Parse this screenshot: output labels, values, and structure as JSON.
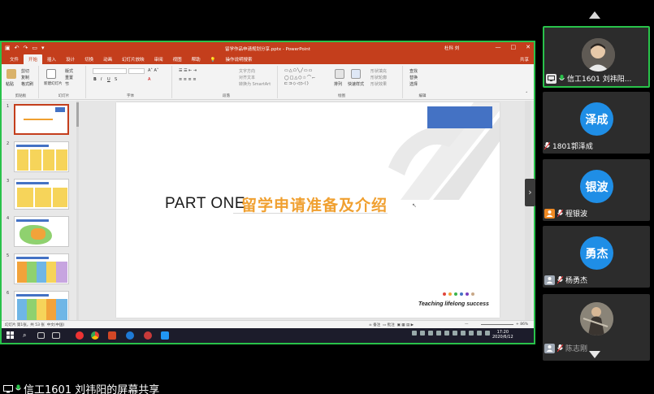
{
  "app": {
    "document_title": "留学作品申请规划分享.pptx - PowerPoint",
    "user": "杜科 刘",
    "tabs": [
      "文件",
      "开始",
      "插入",
      "设计",
      "切换",
      "动画",
      "幻灯片放映",
      "审阅",
      "视图",
      "帮助"
    ],
    "active_tab": "开始",
    "tell_me": "操作说明搜索",
    "share": "共享",
    "window_buttons": [
      "—",
      "□",
      "✕"
    ]
  },
  "ribbon": {
    "groups": [
      {
        "name": "剪贴板",
        "items": [
          "粘贴",
          "剪切",
          "复制",
          "格式刷"
        ]
      },
      {
        "name": "幻灯片",
        "items": [
          "新建幻灯片",
          "版式",
          "重置",
          "节"
        ]
      },
      {
        "name": "字体",
        "items": [
          "B",
          "I",
          "U",
          "S",
          "A"
        ]
      },
      {
        "name": "段落",
        "items": [
          "文字方向",
          "对齐文本",
          "转换为 SmartArt"
        ]
      },
      {
        "name": "绘图",
        "items": [
          "排列",
          "快速样式",
          "形状填充",
          "形状轮廓",
          "形状效果"
        ]
      },
      {
        "name": "编辑",
        "items": [
          "查找",
          "替换",
          "选择"
        ]
      }
    ]
  },
  "thumbnails": [
    {
      "num": "1",
      "selected": true
    },
    {
      "num": "2",
      "selected": false
    },
    {
      "num": "3",
      "selected": false
    },
    {
      "num": "4",
      "selected": false
    },
    {
      "num": "5",
      "selected": false
    },
    {
      "num": "6",
      "selected": false
    }
  ],
  "slide": {
    "part_label": "PART ONE",
    "title": "留学申请准备及介绍",
    "tagline": "Teaching lifelong success",
    "dot_colors": [
      "#e0463c",
      "#f2a33a",
      "#3bb54a",
      "#4472c4",
      "#7a3fbf",
      "#c8a888"
    ]
  },
  "statusbar": {
    "slide_info": "幻灯片 第1张，共 53 张",
    "language": "中文(中国)",
    "notes": "备注",
    "comments": "批注",
    "zoom": "+ 86%"
  },
  "taskbar": {
    "time": "17:20",
    "date": "2020/6/12"
  },
  "participants": [
    {
      "name": "信工1601 刘祎阳...",
      "initials": "",
      "photo": true,
      "sharing": true,
      "active": true
    },
    {
      "name": "1801郭泽成",
      "initials": "泽成",
      "photo": false,
      "sharing": false,
      "active": false
    },
    {
      "name": "程银波",
      "initials": "银波",
      "photo": false,
      "sharing": false,
      "active": false
    },
    {
      "name": "杨勇杰",
      "initials": "勇杰",
      "photo": false,
      "sharing": false,
      "active": false
    },
    {
      "name": "陈志刚",
      "initials": "",
      "photo": true,
      "sharing": false,
      "active": false
    }
  ],
  "caption": "信工1601 刘祎阳的屏幕共享",
  "colors": {
    "frame_green": "#29c24a",
    "ppt_red": "#c43e1c",
    "avatar_blue": "#1f8ee6",
    "title_orange": "#f0a030",
    "slide_blue": "#4472c4"
  }
}
